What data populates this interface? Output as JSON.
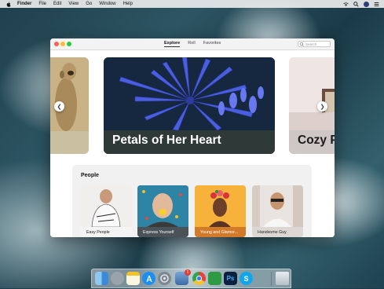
{
  "menubar": {
    "app": "Finder",
    "items": [
      "File",
      "Edit",
      "View",
      "Go",
      "Window",
      "Help"
    ]
  },
  "window": {
    "tabs": [
      "Explore",
      "Roll",
      "Favorites"
    ],
    "active_tab": "Explore",
    "search_placeholder": "Search",
    "featured": {
      "main_title": "Petals of Her Heart",
      "right_title": "Cozy P"
    },
    "people": {
      "heading": "People",
      "cards": [
        "Easy People",
        "Express Yourself",
        "Young and Glamor...",
        "Handsome Guy"
      ]
    }
  },
  "dock": {
    "badge_count": "1",
    "apps": [
      "finder-icon",
      "launchpad-icon",
      "notes-icon",
      "app-store-icon",
      "system-preferences-icon",
      "preview-icon",
      "chrome-icon",
      "evernote-icon",
      "photoshop-icon",
      "skype-icon",
      "trash-icon"
    ]
  },
  "colors": {
    "accent": "#2f3a38",
    "menubar": "#ebebeb"
  }
}
